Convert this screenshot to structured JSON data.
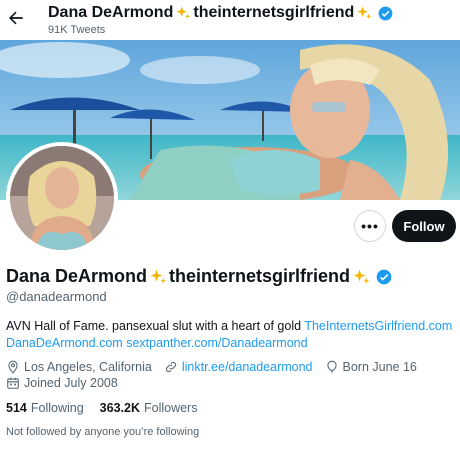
{
  "header": {
    "display_name": "Dana DeArmond",
    "display_suffix": "theinternetsgirlfriend",
    "tweet_count": "91K Tweets"
  },
  "actions": {
    "more_label": "•••",
    "follow_label": "Follow"
  },
  "profile": {
    "name": "Dana DeArmond",
    "name_suffix": "theinternetsgirlfriend",
    "handle": "@danadearmond",
    "bio_text": "AVN Hall of Fame. pansexual slut with a heart of gold",
    "bio_link1": "TheInternetsGirlfriend.com",
    "bio_link2": "DanaDeArmond.com",
    "bio_link3": "sextpanther.com/Danadearmond",
    "location": "Los Angeles, California",
    "website": "linktr.ee/danadearmond",
    "birthday": "Born June 16",
    "joined": "Joined July 2008"
  },
  "stats": {
    "following_count": "514",
    "following_label": "Following",
    "followers_count": "363.2K",
    "followers_label": "Followers"
  },
  "footer": {
    "not_followed": "Not followed by anyone you’re following"
  },
  "colors": {
    "accent": "#1d9bf0",
    "text": "#0f1419",
    "muted": "#536471",
    "follow_bg": "#0f1419",
    "sparkle": "#f5b400"
  },
  "icons": {
    "back": "arrow-left-icon",
    "sparkle": "sparkles-icon",
    "verified": "verified-badge-icon",
    "location": "location-pin-icon",
    "link": "link-icon",
    "birthday": "balloon-icon",
    "calendar": "calendar-icon"
  }
}
